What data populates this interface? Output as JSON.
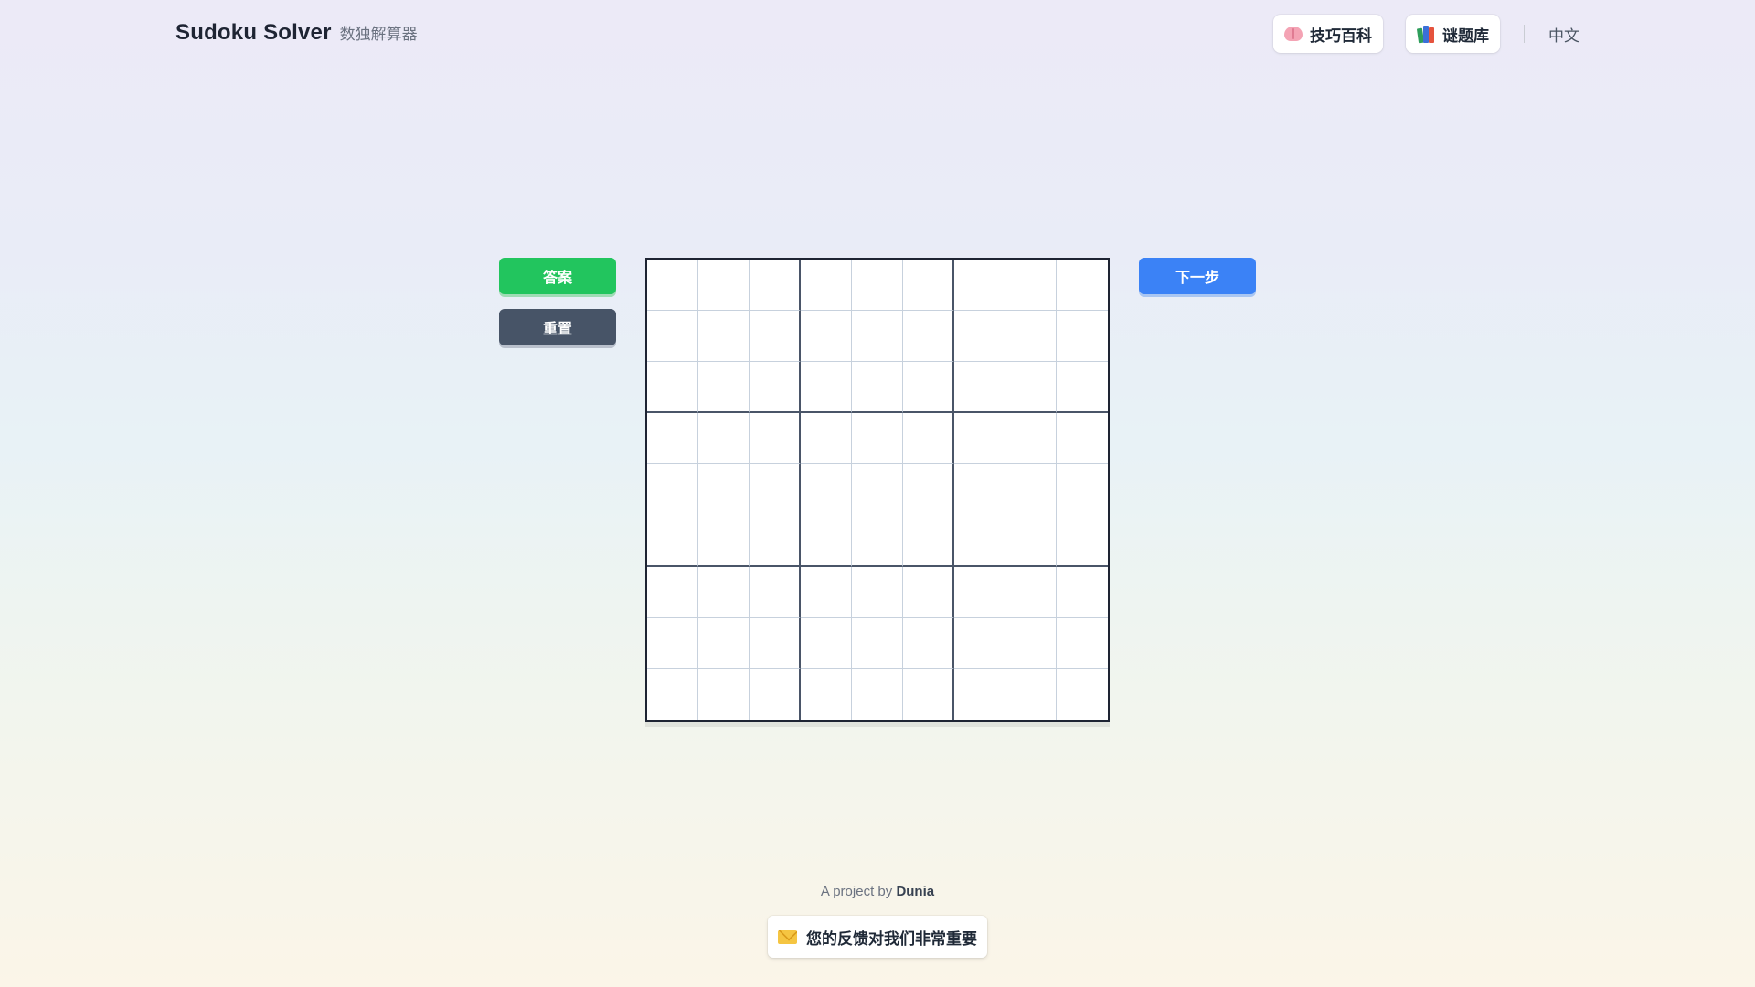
{
  "header": {
    "title": "Sudoku Solver",
    "subtitle": "数独解算器",
    "nav": [
      {
        "label": "技巧百科",
        "icon": "brain-icon"
      },
      {
        "label": "谜题库",
        "icon": "books-icon"
      }
    ],
    "language": "中文"
  },
  "actions": {
    "answer_label": "答案",
    "reset_label": "重置",
    "next_label": "下一步"
  },
  "board": {
    "size": 9,
    "cells": [
      [
        "",
        "",
        "",
        "",
        "",
        "",
        "",
        "",
        ""
      ],
      [
        "",
        "",
        "",
        "",
        "",
        "",
        "",
        "",
        ""
      ],
      [
        "",
        "",
        "",
        "",
        "",
        "",
        "",
        "",
        ""
      ],
      [
        "",
        "",
        "",
        "",
        "",
        "",
        "",
        "",
        ""
      ],
      [
        "",
        "",
        "",
        "",
        "",
        "",
        "",
        "",
        ""
      ],
      [
        "",
        "",
        "",
        "",
        "",
        "",
        "",
        "",
        ""
      ],
      [
        "",
        "",
        "",
        "",
        "",
        "",
        "",
        "",
        ""
      ],
      [
        "",
        "",
        "",
        "",
        "",
        "",
        "",
        "",
        ""
      ],
      [
        "",
        "",
        "",
        "",
        "",
        "",
        "",
        "",
        ""
      ]
    ]
  },
  "footer": {
    "credit_prefix": "A project by",
    "credit_name": "Dunia",
    "feedback_label": "您的反馈对我们非常重要",
    "feedback_icon": "envelope-icon"
  },
  "colors": {
    "answer": "#22c55e",
    "reset": "#475467",
    "next": "#3b82f6"
  }
}
